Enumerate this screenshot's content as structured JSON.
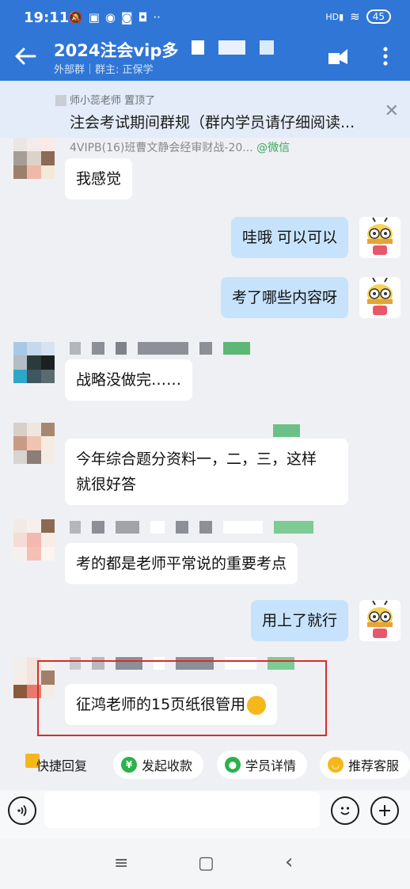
{
  "status_bar": {
    "time": "19:11",
    "battery": "45",
    "signal_label": "HD"
  },
  "header": {
    "title": "2024注会vip多",
    "subtitle": "外部群｜群主: 正保学",
    "back_icon": "arrow-left-icon",
    "colors": {
      "bg": "#2f76d6"
    }
  },
  "pinned": {
    "by": "师小蕊老师 置顶了",
    "text": "注会考试期间群规（群内学员请仔细阅读...",
    "close": "✕"
  },
  "messages": [
    {
      "side": "left",
      "sender": "4VIPB(16)班曹文静会经审财战-20...",
      "sender_tag": "@微信",
      "text": "我感觉"
    },
    {
      "side": "right",
      "text": "哇哦 可以可以"
    },
    {
      "side": "right",
      "text": "考了哪些内容呀"
    },
    {
      "side": "left",
      "text": "战略没做完……"
    },
    {
      "side": "left",
      "text": "今年综合题分资料一，二，三，这样\n就很好答"
    },
    {
      "side": "left",
      "text": "考的都是老师平常说的重要考点"
    },
    {
      "side": "right",
      "text": "用上了就行"
    },
    {
      "side": "left",
      "text": "征鸿老师的15页纸很管用"
    }
  ],
  "quick_replies": [
    {
      "label": "快捷回复",
      "icon": "quick-reply-icon",
      "color": "#f5b71b"
    },
    {
      "label": "发起收款",
      "icon": "yuan-icon",
      "color": "#2bb24c"
    },
    {
      "label": "学员详情",
      "icon": "user-icon",
      "color": "#2bb24c"
    },
    {
      "label": "推荐客服",
      "icon": "smile-icon",
      "color": "#f5b71b"
    }
  ],
  "input_bar": {
    "voice_icon": "voice-icon",
    "emoji_icon": "emoji-icon",
    "plus_icon": "plus-icon"
  },
  "nav": {
    "menu": "≡",
    "home": "▢",
    "back": "‹"
  }
}
